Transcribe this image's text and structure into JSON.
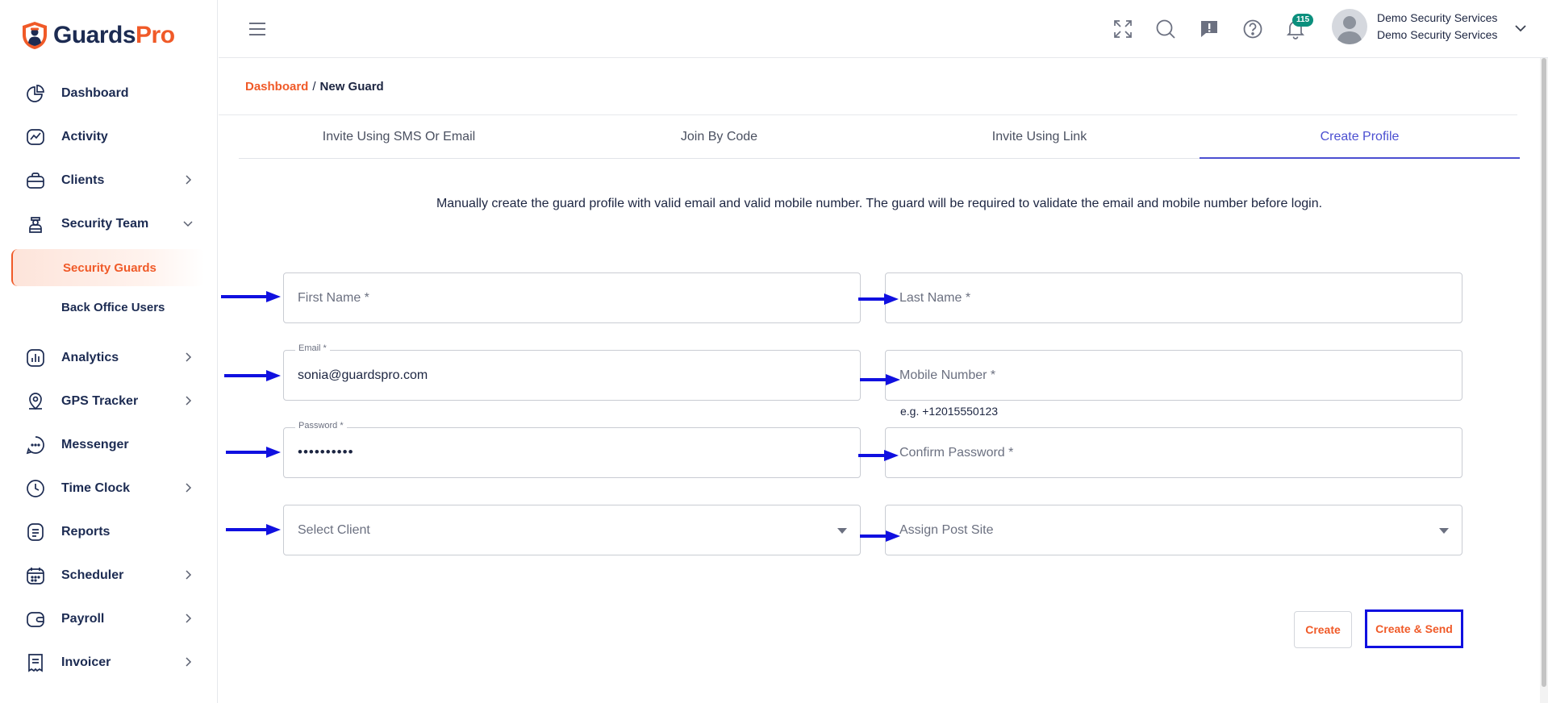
{
  "brand": {
    "name_part1": "Guards",
    "name_part2": "Pro",
    "accent": "#f05a28",
    "navy": "#1c2b52"
  },
  "sidebar": {
    "items": [
      {
        "label": "Dashboard",
        "icon": "dashboard-icon"
      },
      {
        "label": "Activity",
        "icon": "activity-icon"
      },
      {
        "label": "Clients",
        "icon": "briefcase-icon"
      },
      {
        "label": "Security Team",
        "icon": "guard-icon"
      },
      {
        "label": "Analytics",
        "icon": "analytics-icon"
      },
      {
        "label": "GPS Tracker",
        "icon": "location-icon"
      },
      {
        "label": "Messenger",
        "icon": "chat-icon"
      },
      {
        "label": "Time Clock",
        "icon": "clock-icon"
      },
      {
        "label": "Reports",
        "icon": "report-icon"
      },
      {
        "label": "Scheduler",
        "icon": "calendar-icon"
      },
      {
        "label": "Payroll",
        "icon": "wallet-icon"
      },
      {
        "label": "Invoicer",
        "icon": "invoice-icon"
      }
    ],
    "sub_items": {
      "security_guards": "Security Guards",
      "back_office_users": "Back Office Users"
    }
  },
  "header": {
    "notification_count": "115",
    "user_name": "Demo Security Services",
    "user_org": "Demo Security Services"
  },
  "breadcrumb": {
    "root": "Dashboard",
    "separator": "/",
    "current": "New Guard"
  },
  "tabs": [
    {
      "label": "Invite Using SMS Or Email"
    },
    {
      "label": "Join By Code"
    },
    {
      "label": "Invite Using Link"
    },
    {
      "label": "Create Profile"
    }
  ],
  "intro_text": "Manually create the guard profile with valid email and valid mobile number. The guard will be required to validate the email and mobile number before login.",
  "form": {
    "first_name_placeholder": "First Name *",
    "last_name_placeholder": "Last Name *",
    "email_label": "Email *",
    "email_value": "sonia@guardspro.com",
    "mobile_placeholder": "Mobile Number *",
    "mobile_helper": "e.g. +12015550123",
    "password_label": "Password *",
    "password_value": "••••••••••",
    "confirm_password_placeholder": "Confirm Password *",
    "select_client_placeholder": "Select Client",
    "assign_post_site_placeholder": "Assign Post Site"
  },
  "actions": {
    "create_label": "Create",
    "create_send_label": "Create & Send"
  },
  "annotation_color": "#1010e0"
}
